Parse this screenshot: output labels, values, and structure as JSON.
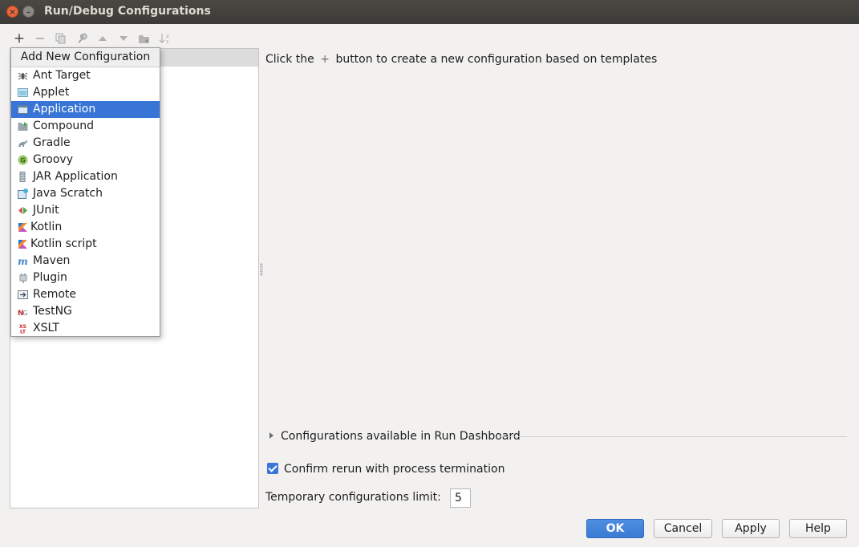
{
  "window": {
    "title": "Run/Debug Configurations",
    "close_glyph": "×",
    "minimize_glyph": "–"
  },
  "toolbar": {
    "icons": [
      "add-icon",
      "remove-icon",
      "copy-icon",
      "wrench-icon",
      "move-up-icon",
      "move-down-icon",
      "folder-icon",
      "sort-icon"
    ],
    "add_glyph": "+",
    "remove_glyph": "−"
  },
  "popup": {
    "title": "Add New Configuration",
    "items": [
      {
        "label": "Ant Target",
        "icon": "ant-icon"
      },
      {
        "label": "Applet",
        "icon": "applet-icon"
      },
      {
        "label": "Application",
        "icon": "application-icon",
        "selected": true
      },
      {
        "label": "Compound",
        "icon": "compound-icon"
      },
      {
        "label": "Gradle",
        "icon": "gradle-icon"
      },
      {
        "label": "Groovy",
        "icon": "groovy-icon"
      },
      {
        "label": "JAR Application",
        "icon": "jar-icon"
      },
      {
        "label": "Java Scratch",
        "icon": "java-scratch-icon"
      },
      {
        "label": "JUnit",
        "icon": "junit-icon"
      },
      {
        "label": "Kotlin",
        "icon": "kotlin-icon"
      },
      {
        "label": "Kotlin script",
        "icon": "kotlin-script-icon"
      },
      {
        "label": "Maven",
        "icon": "maven-icon"
      },
      {
        "label": "Plugin",
        "icon": "plugin-icon"
      },
      {
        "label": "Remote",
        "icon": "remote-icon"
      },
      {
        "label": "TestNG",
        "icon": "testng-icon"
      },
      {
        "label": "XSLT",
        "icon": "xslt-icon"
      }
    ]
  },
  "main": {
    "hint_before": "Click the",
    "hint_plus": "+",
    "hint_after": "button to create a new configuration based on templates",
    "dashboard_label": "Configurations available in Run Dashboard",
    "confirm_rerun_label": "Confirm rerun with process termination",
    "confirm_rerun_checked": true,
    "temp_limit_label": "Temporary configurations limit:",
    "temp_limit_value": "5"
  },
  "buttons": {
    "ok": "OK",
    "cancel": "Cancel",
    "apply": "Apply",
    "help": "Help"
  },
  "colors": {
    "selection": "#3875d7",
    "title_bar": "#3c3b37",
    "close": "#e9663c"
  }
}
